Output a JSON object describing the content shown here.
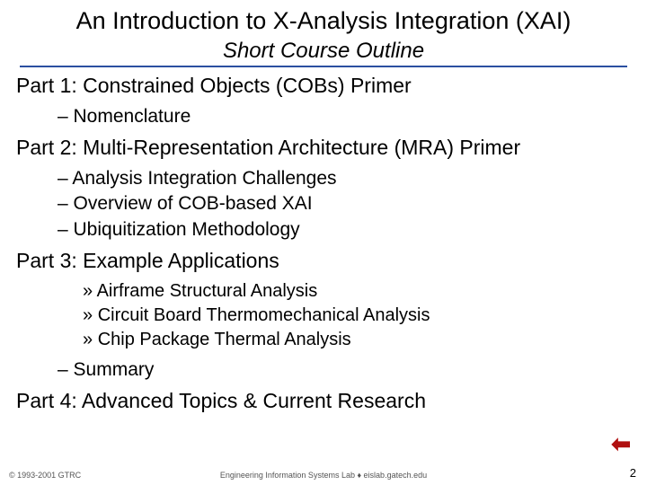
{
  "title": "An Introduction to X-Analysis Integration (XAI)",
  "subtitle": "Short Course Outline",
  "part1": {
    "heading": "Part 1: Constrained Objects (COBs) Primer",
    "items": [
      "Nomenclature"
    ]
  },
  "part2": {
    "heading": "Part 2: Multi-Representation Architecture (MRA) Primer",
    "items": [
      "Analysis Integration Challenges",
      "Overview of COB-based XAI",
      "Ubiquitization Methodology"
    ]
  },
  "part3": {
    "heading": "Part 3: Example Applications",
    "sub_items": [
      "Airframe Structural Analysis",
      "Circuit Board Thermomechanical Analysis",
      "Chip Package Thermal Analysis"
    ],
    "items": [
      "Summary"
    ]
  },
  "part4": {
    "heading": "Part 4: Advanced Topics & Current Research"
  },
  "footer": {
    "left": "© 1993-2001 GTRC",
    "center": "Engineering Information Systems Lab ♦ eislab.gatech.edu",
    "page": "2"
  }
}
